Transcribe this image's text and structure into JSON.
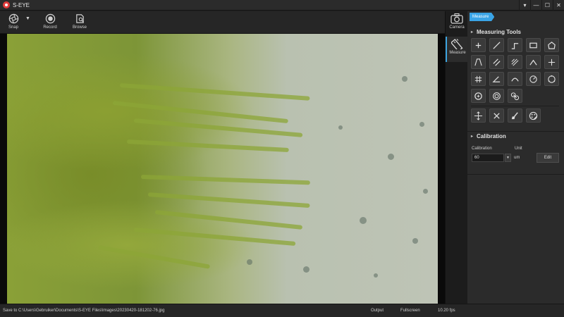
{
  "window": {
    "title": "S-EYE",
    "controls": {
      "menu": "▾",
      "minimize": "—",
      "maximize": "☐",
      "close": "✕"
    }
  },
  "toolbar": {
    "snap_label": "Snap",
    "record_label": "Record",
    "browse_label": "Browse",
    "snap_icon": "camera-shutter-icon",
    "record_icon": "record-icon",
    "browse_icon": "browse-folder-icon"
  },
  "modes": [
    {
      "label": "Camera",
      "icon": "camera-icon",
      "active": false
    },
    {
      "label": "Measure",
      "icon": "ruler-icon",
      "active": true
    }
  ],
  "panel": {
    "tab_label": "Measure",
    "measuring_tools_title": "Measuring Tools",
    "tools": [
      "pointer-cross-icon",
      "line-icon",
      "polyline-icon",
      "rectangle-icon",
      "polygon-icon",
      "angle-lines-icon",
      "parallel-lines-icon",
      "multi-parallel-icon",
      "angle-icon",
      "perpendicular-icon",
      "grid-cross-icon",
      "angle-vertex-icon",
      "arc-icon",
      "circle-radius-icon",
      "circle-three-point-icon",
      "circle-center-icon",
      "concentric-circles-icon",
      "two-circles-distance-icon"
    ],
    "actions": [
      "move-select-icon",
      "delete-icon",
      "clear-brush-icon",
      "color-palette-icon"
    ],
    "calibration_title": "Calibration",
    "calibration_label": "Calibration",
    "unit_label": "Unit",
    "calibration_value": "60",
    "unit_value": "um",
    "edit_label": "Edit"
  },
  "statusbar": {
    "save_path": "Save to C:\\Users\\Gebruiker\\Documents\\S-EYE Files\\Images\\20230420-181202-76.jpg",
    "output": "Output",
    "fullscreen": "Fullscreen",
    "fps": "10.20 fps"
  },
  "colors": {
    "accent": "#3aa4e6",
    "panel_bg": "#2b2b2b",
    "toolbar_bg": "#262626"
  }
}
